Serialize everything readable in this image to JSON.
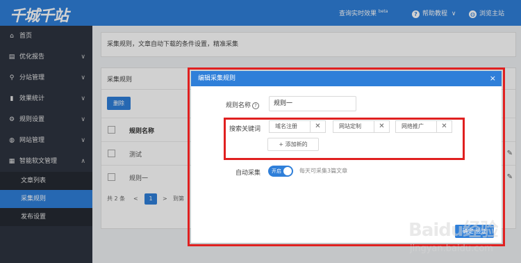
{
  "header": {
    "logo": "千城千站",
    "search_effect": "查询实时效果",
    "beta": "beta",
    "help": "帮助教程",
    "browse": "浏览主站"
  },
  "sidebar": {
    "items": [
      {
        "label": "首页",
        "icon": "home-icon",
        "glyph": "⌂"
      },
      {
        "label": "优化报告",
        "icon": "report-icon",
        "glyph": "▤"
      },
      {
        "label": "分站管理",
        "icon": "location-icon",
        "glyph": "⚲"
      },
      {
        "label": "效果统计",
        "icon": "bar-chart-icon",
        "glyph": "▮"
      },
      {
        "label": "规则设置",
        "icon": "gear-icon",
        "glyph": "⚙"
      },
      {
        "label": "网站管理",
        "icon": "globe-icon",
        "glyph": "◍"
      },
      {
        "label": "智能软文管理",
        "icon": "document-icon",
        "glyph": "▦"
      }
    ],
    "sub_items": [
      {
        "label": "文章列表"
      },
      {
        "label": "采集规则",
        "active": true
      },
      {
        "label": "发布设置"
      }
    ]
  },
  "main": {
    "description": "采集规则，文章自动下载的条件设置，精准采集",
    "panel_title": "采集规则",
    "delete_label": "删除",
    "table": {
      "header": "规则名称",
      "rows": [
        "测试",
        "规则一"
      ]
    },
    "pager": {
      "total": "共 2 条",
      "prev": "<",
      "page": "1",
      "next": ">",
      "goto": "到第"
    }
  },
  "modal": {
    "title": "编辑采集规则",
    "close": "×",
    "rule_name_label": "规则名称",
    "rule_name_value": "规则一",
    "keywords_label": "搜索关键词",
    "keywords": [
      "域名注册",
      "网站定制",
      "网络推广"
    ],
    "add_label": "+ 添加新的",
    "auto_label": "自动采集",
    "toggle_text": "开启",
    "hint": "每天可采集3篇文章",
    "confirm": "确定 验证"
  },
  "watermark": {
    "main": "Baidu经验",
    "sub": "jingyan.baidu.com"
  },
  "colors": {
    "primary": "#2f7fd9",
    "sidebar": "#2e3440",
    "highlight_frame": "#e02020"
  }
}
